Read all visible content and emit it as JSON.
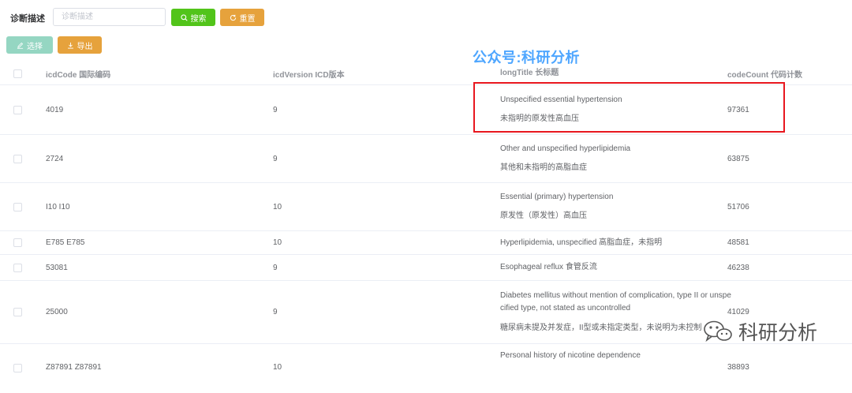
{
  "search": {
    "label": "诊断描述",
    "placeholder": "诊断描述",
    "value": "",
    "search_button": "搜索",
    "reset_button": "重置"
  },
  "toolbar": {
    "select_button": "选择",
    "export_button": "导出"
  },
  "watermark": {
    "top": "公众号:科研分析",
    "bottom": "科研分析"
  },
  "table": {
    "headers": {
      "code": "icdCode 国际编码",
      "version": "icdVersion ICD版本",
      "title": "longTitle 长标题",
      "count": "codeCount 代码计数"
    },
    "rows": [
      {
        "code": "4019",
        "version": "9",
        "title_en": "Unspecified essential hypertension",
        "title_cn": "未指明的原发性高血压",
        "count": "97361"
      },
      {
        "code": "2724",
        "version": "9",
        "title_en": "Other and unspecified hyperlipidemia",
        "title_cn": "其他和未指明的高脂血症",
        "count": "63875"
      },
      {
        "code": "I10  I10",
        "version": "10",
        "title_en": "Essential (primary) hypertension",
        "title_cn": "原发性（原发性）高血压",
        "count": "51706"
      },
      {
        "code": "E785  E785",
        "version": "10",
        "title_en": "Hyperlipidemia, unspecified 高脂血症，未指明",
        "title_cn": "",
        "count": "48581"
      },
      {
        "code": "53081",
        "version": "9",
        "title_en": "Esophageal reflux 食管反流",
        "title_cn": "",
        "count": "46238"
      },
      {
        "code": "25000",
        "version": "9",
        "title_en": "Diabetes mellitus without mention of complication, type II or unspe",
        "title_en2": "cified type, not stated as uncontrolled",
        "title_cn": "糖尿病未提及并发症，II型或未指定类型，未说明为未控制",
        "count": "41029"
      },
      {
        "code": "Z87891  Z87891",
        "version": "10",
        "title_en": "Personal history of nicotine dependence",
        "title_cn": "",
        "count": "38893"
      }
    ]
  },
  "colors": {
    "search_button": "#52c41a",
    "reset_button": "#e6a23c",
    "select_button": "#95d6c2",
    "export_button": "#e6a23c",
    "highlight_box": "#e8171f",
    "watermark_top": "#4ea6ff"
  }
}
